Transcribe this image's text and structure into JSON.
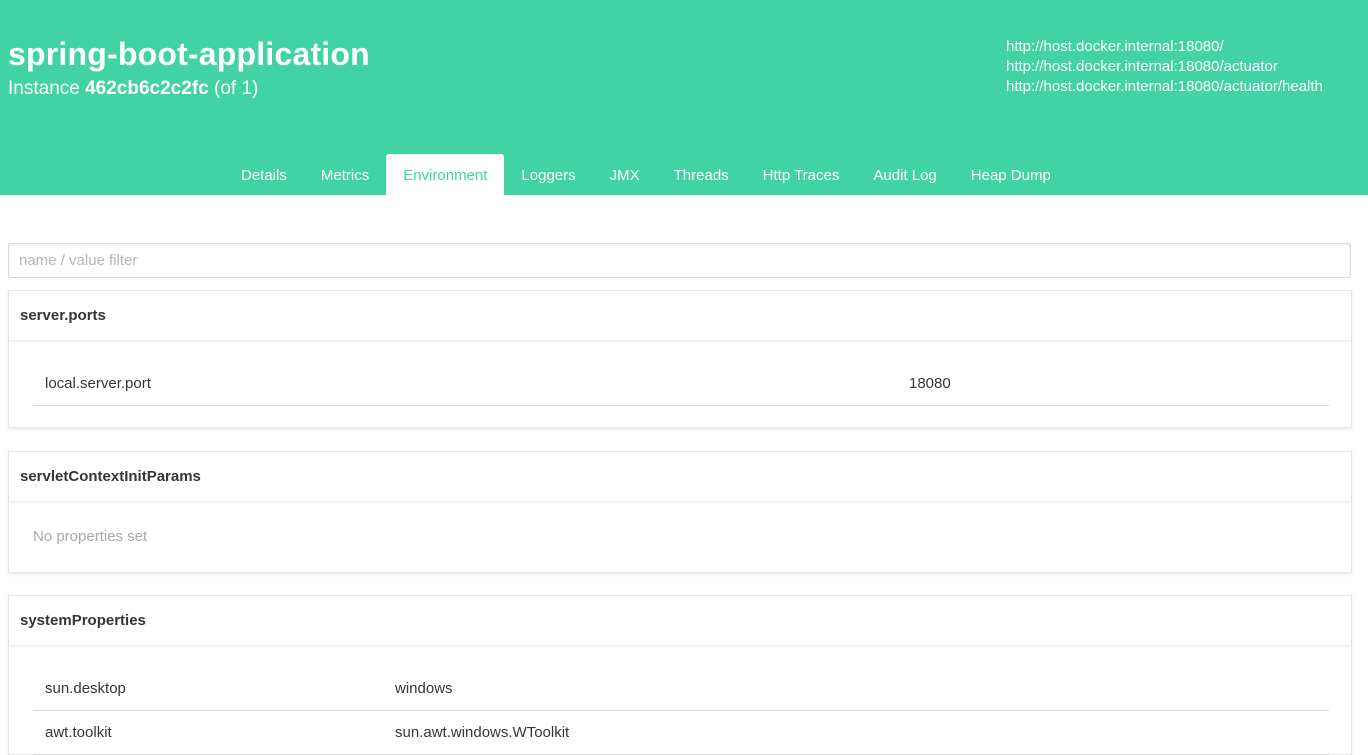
{
  "header": {
    "app_name": "spring-boot-application",
    "instance_prefix": "Instance",
    "instance_id": "462cb6c2c2fc",
    "instance_count": "(of 1)",
    "urls": [
      "http://host.docker.internal:18080/",
      "http://host.docker.internal:18080/actuator",
      "http://host.docker.internal:18080/actuator/health"
    ]
  },
  "tabs": [
    {
      "label": "Details"
    },
    {
      "label": "Metrics"
    },
    {
      "label": "Environment",
      "active": true
    },
    {
      "label": "Loggers"
    },
    {
      "label": "JMX"
    },
    {
      "label": "Threads"
    },
    {
      "label": "Http Traces"
    },
    {
      "label": "Audit Log"
    },
    {
      "label": "Heap Dump"
    }
  ],
  "filter": {
    "placeholder": "name / value filter",
    "value": ""
  },
  "sections": [
    {
      "title": "server.ports",
      "properties": [
        {
          "name": "local.server.port",
          "value": "18080"
        }
      ]
    },
    {
      "title": "servletContextInitParams",
      "empty_text": "No properties set"
    },
    {
      "title": "systemProperties",
      "properties": [
        {
          "name": "sun.desktop",
          "value": "windows"
        },
        {
          "name": "awt.toolkit",
          "value": "sun.awt.windows.WToolkit"
        }
      ]
    }
  ],
  "colors": {
    "accent": "#42d3a5",
    "text": "#363636",
    "muted": "#a9a9a9"
  }
}
